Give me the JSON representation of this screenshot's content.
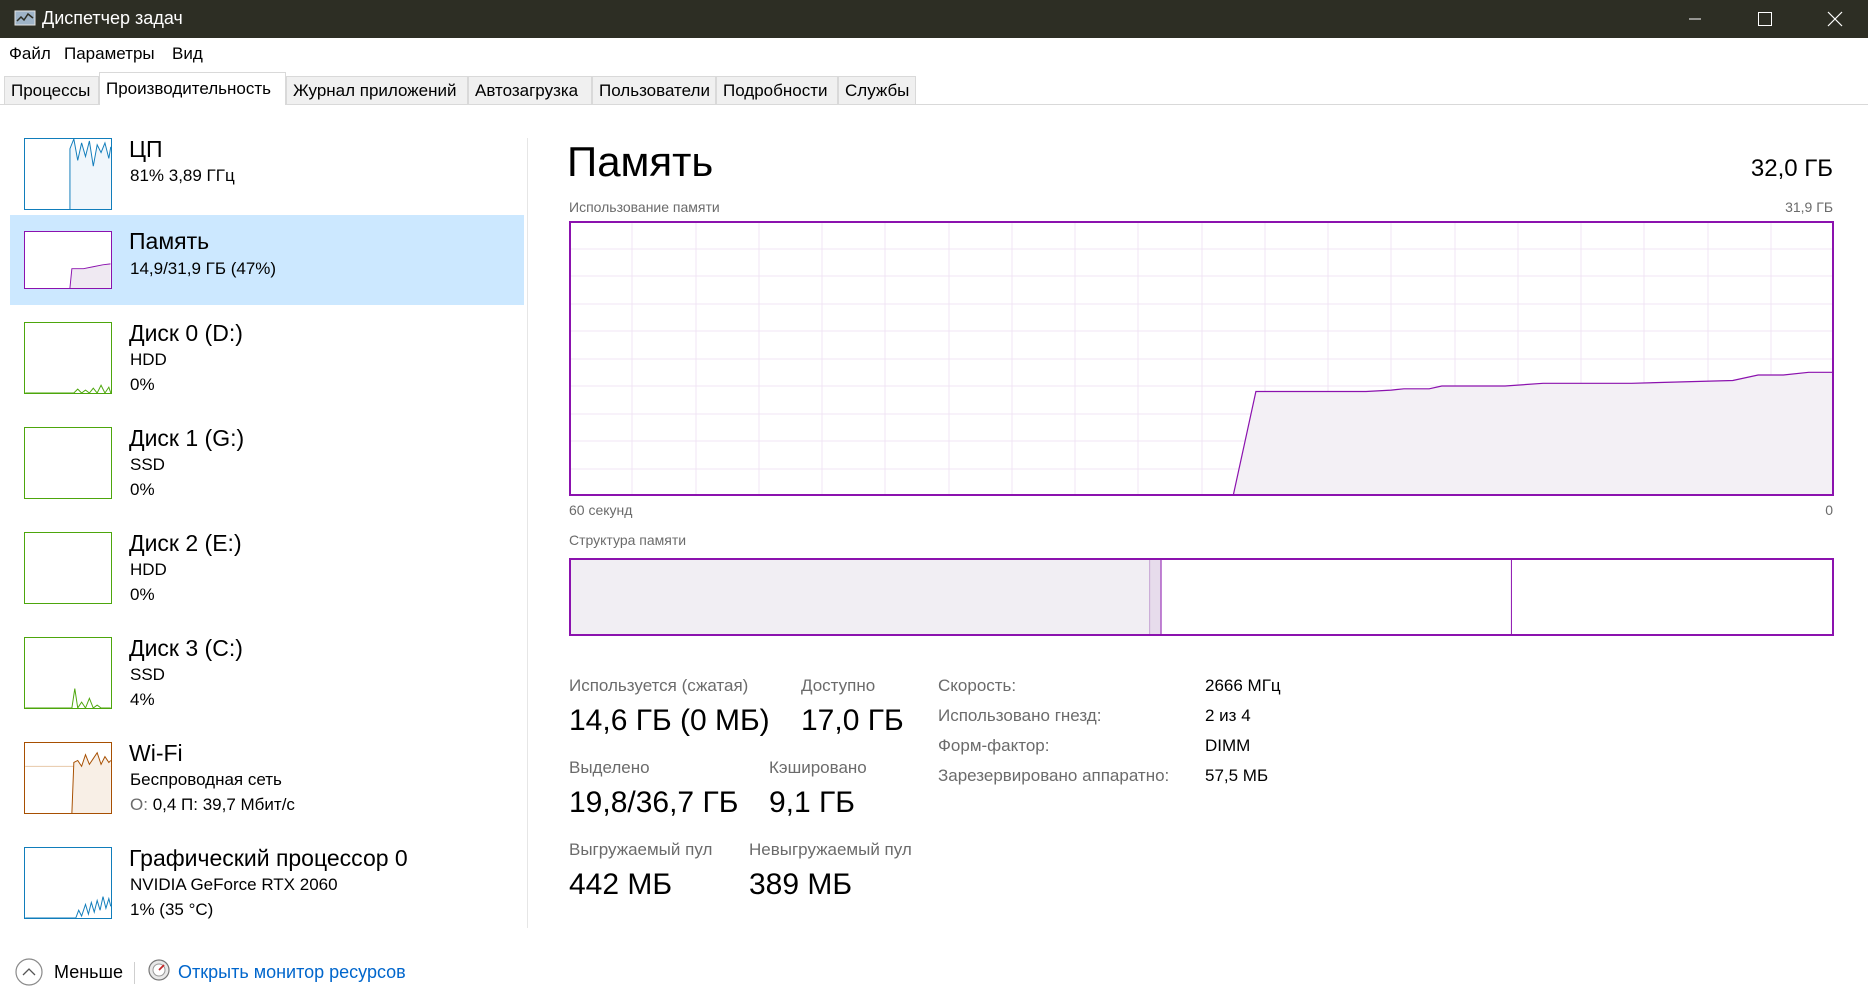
{
  "window": {
    "title": "Диспетчер задач"
  },
  "menu": [
    "Файл",
    "Параметры",
    "Вид"
  ],
  "tabs": [
    "Процессы",
    "Производительность",
    "Журнал приложений",
    "Автозагрузка",
    "Пользователи",
    "Подробности",
    "Службы"
  ],
  "active_tab": "Производительность",
  "sidebar": {
    "items": [
      {
        "title": "ЦП",
        "line1": "81%  3,89 ГГц",
        "line2": "",
        "color": "#117dbb"
      },
      {
        "title": "Память",
        "line1": "14,9/31,9 ГБ (47%)",
        "line2": "",
        "color": "#8b12ae",
        "selected": true
      },
      {
        "title": "Диск 0 (D:)",
        "line1": "HDD",
        "line2": "0%",
        "color": "#4da60c"
      },
      {
        "title": "Диск 1 (G:)",
        "line1": "SSD",
        "line2": "0%",
        "color": "#4da60c"
      },
      {
        "title": "Диск 2 (E:)",
        "line1": "HDD",
        "line2": "0%",
        "color": "#4da60c"
      },
      {
        "title": "Диск 3 (C:)",
        "line1": "SSD",
        "line2": "4%",
        "color": "#4da60c"
      },
      {
        "title": "Wi-Fi",
        "line1": "Беспроводная сеть",
        "line2_label": "О:",
        "line2_value": "0,4  П: 39,7 Мбит/с",
        "color": "#a74f01"
      },
      {
        "title": "Графический процессор 0",
        "line1": "NVIDIA GeForce RTX 2060",
        "line2": "1%  (35 °C)",
        "color": "#117dbb"
      }
    ]
  },
  "main": {
    "title": "Память",
    "total": "32,0 ГБ",
    "usage_graph": {
      "label": "Использование памяти",
      "max_label": "31,9 ГБ",
      "x_left": "60 секунд",
      "x_right": "0",
      "color": "#8b12ae",
      "fill": "#f3f0f5"
    },
    "composition": {
      "label": "Структура памяти",
      "segments_fraction": {
        "in_use": 0.459,
        "modified": 0.009,
        "standby": 0.277,
        "free": 0.255
      }
    },
    "stats": {
      "in_use_label": "Используется (сжатая)",
      "in_use_value": "14,6 ГБ (0 МБ)",
      "available_label": "Доступно",
      "available_value": "17,0 ГБ",
      "committed_label": "Выделено",
      "committed_value": "19,8/36,7 ГБ",
      "cached_label": "Кэшировано",
      "cached_value": "9,1 ГБ",
      "paged_label": "Выгружаемый пул",
      "paged_value": "442 МБ",
      "nonpaged_label": "Невыгружаемый пул",
      "nonpaged_value": "389 МБ"
    },
    "details": [
      {
        "label": "Скорость:",
        "value": "2666 МГц"
      },
      {
        "label": "Использовано гнезд:",
        "value": "2 из 4"
      },
      {
        "label": "Форм-фактор:",
        "value": "DIMM"
      },
      {
        "label": "Зарезервировано аппаратно:",
        "value": "57,5 МБ"
      }
    ]
  },
  "footer": {
    "fewer_label": "Меньше",
    "monitor_link": "Открыть монитор ресурсов"
  }
}
